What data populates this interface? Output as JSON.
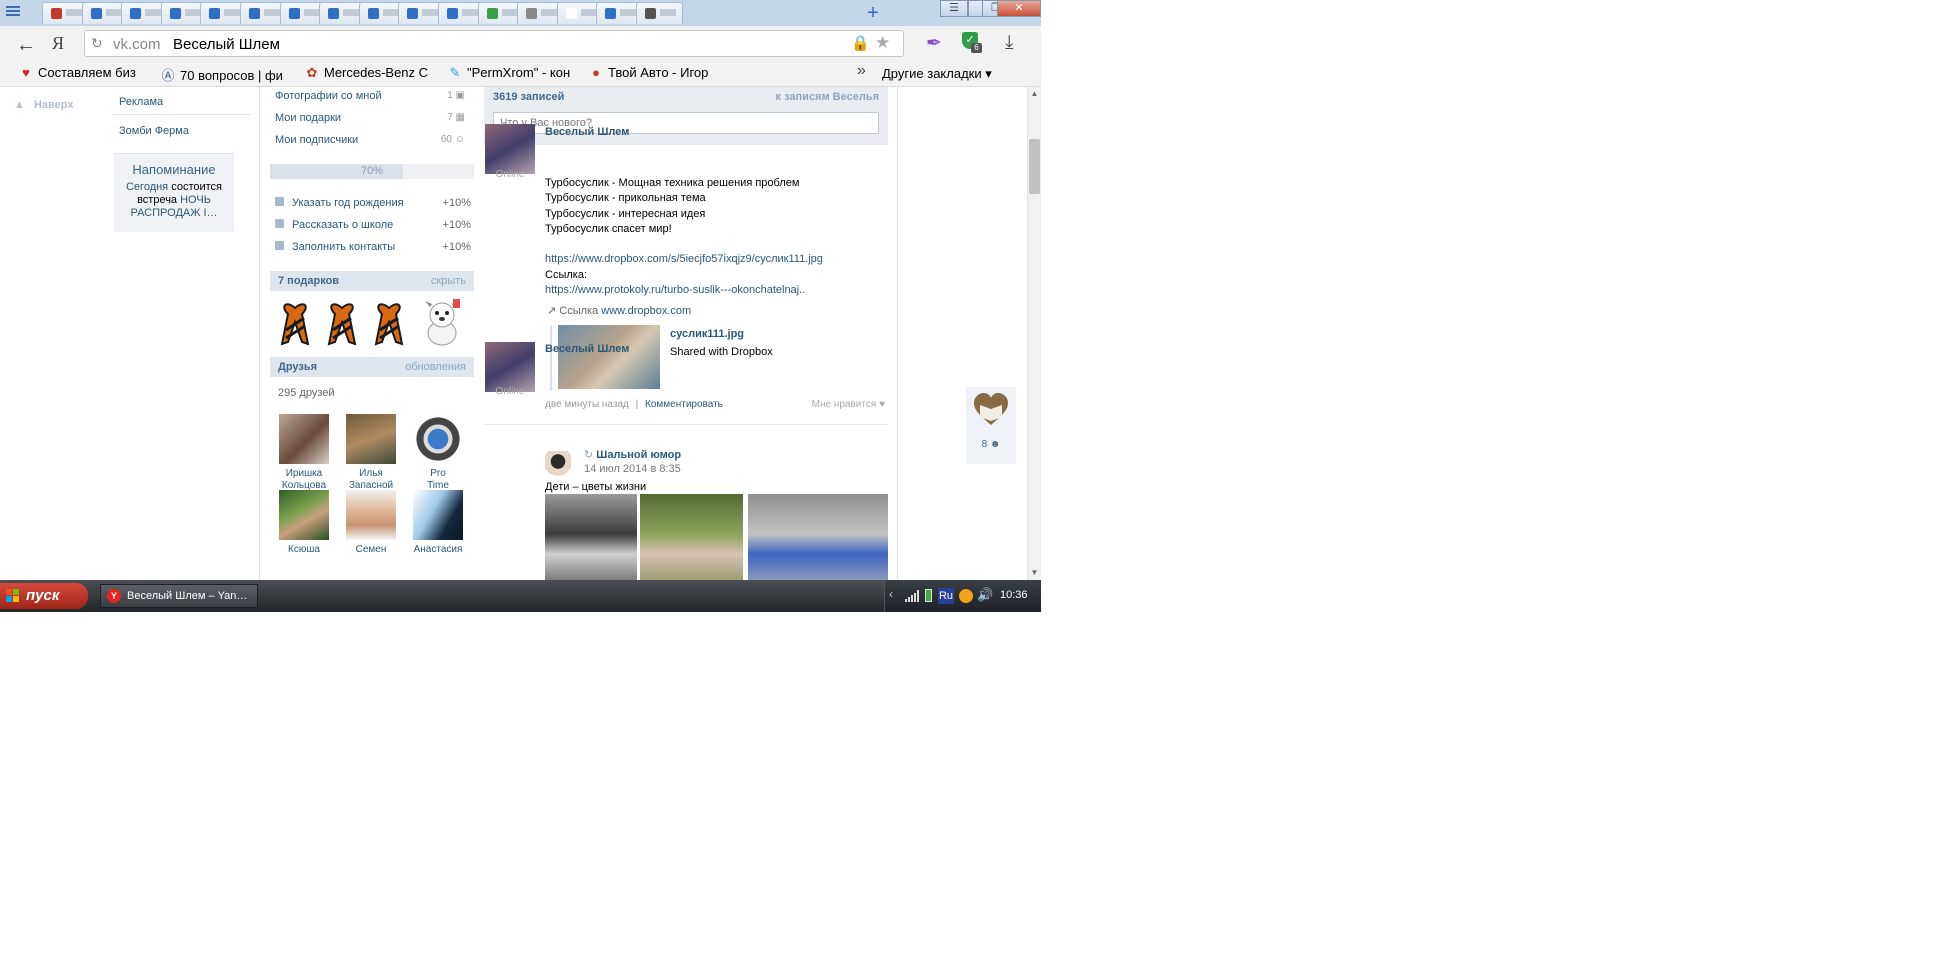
{
  "browser": {
    "tab_count": 16,
    "tab_favicon_colors": [
      "#c0392b",
      "#2f6fc4",
      "#2f6fc4",
      "#2f6fc4",
      "#2f6fc4",
      "#2f6fc4",
      "#2f6fc4",
      "#2f6fc4",
      "#2f6fc4",
      "#2f6fc4",
      "#2f6fc4",
      "#3a9e47",
      "#888888",
      "#ffffff",
      "#2f6fc4",
      "#555555"
    ],
    "new_tab_label": "+",
    "window_buttons": {
      "minimize": "—",
      "maximize": "❐",
      "close": "✕"
    },
    "back_icon": "arrow-left-icon",
    "yandex_logo": "Я",
    "address": {
      "domain": "vk.com",
      "title": "Веселый Шлем"
    },
    "bookmarks": [
      {
        "label": "Составляем биз",
        "icon": "♥",
        "color": "#d0202a"
      },
      {
        "label": "70 вопросов | фи",
        "icon": "(A)",
        "color": "#3b5b9a"
      },
      {
        "label": "Mercedes-Benz C",
        "icon": "♣",
        "color": "#c0392b"
      },
      {
        "label": "\"PermXrom\" - кон",
        "icon": "✎",
        "color": "#2a9fd8"
      },
      {
        "label": "Твой Авто - Игор",
        "icon": "🚗",
        "color": "#c0392b"
      }
    ],
    "bookmarks_more": "»",
    "other_bookmarks": "Другие закладки ▾",
    "extension_badge": "6"
  },
  "page": {
    "back_to_top": "Наверх",
    "left_menu": [
      "Реклама",
      "Зомби Ферма"
    ],
    "reminder": {
      "title": "Напоминание",
      "text_before": "Сегодня",
      "text_mid": "состоится встреча",
      "text_link": "НОЧЬ РАСПРОДАЖ І…"
    },
    "profile_links": [
      {
        "label": "Фотографии со мной",
        "count": "1"
      },
      {
        "label": "Мои подарки",
        "count": "7"
      },
      {
        "label": "Мои подписчики",
        "count": "60"
      }
    ],
    "profile_completion": {
      "percent_label": "70%",
      "fraction": 0.7
    },
    "profile_tasks": [
      {
        "label": "Указать год рождения",
        "bonus": "+10%"
      },
      {
        "label": "Рассказать о школе",
        "bonus": "+10%"
      },
      {
        "label": "Заполнить контакты",
        "bonus": "+10%"
      }
    ],
    "gifts": {
      "title": "7 подарков",
      "action": "скрыть"
    },
    "friends": {
      "title": "Друзья",
      "action": "обновления",
      "count_label": "295 друзей",
      "items": [
        {
          "first": "Иришка",
          "last": "Кольцова"
        },
        {
          "first": "Илья",
          "last": "Запасной"
        },
        {
          "first": "Pro",
          "last": "Time"
        },
        {
          "first": "Ксюша",
          "last": ""
        },
        {
          "first": "Семен",
          "last": ""
        },
        {
          "first": "Анастасия",
          "last": ""
        }
      ]
    },
    "wall": {
      "count": "3619 записей",
      "to_posts": "к записям Веселья",
      "input_placeholder": "Что у Вас нового?"
    },
    "post1": {
      "author": "Веселый Шлем",
      "status": "Online",
      "lines": [
        "Турбосуслик - Мощная техника решения проблем",
        "Турбосуслик - прикольная тема",
        "Турбосуслик - интересная идея",
        "Турбосуслик спасет мир!"
      ],
      "link1": "https://www.dropbox.com/s/5iecjfo57ixqjz9/суслик111.jpg",
      "link_label": "Ссылка:",
      "link2": "https://www.protokoly.ru/turbo-suslik---okonchatelnaj..",
      "attachment_prefix": "Ссылка",
      "attachment_domain": "www.dropbox.com",
      "attachment_title": "суслик111.jpg",
      "attachment_subtitle": "Shared with Dropbox",
      "time": "две минуты назад",
      "separator": "|",
      "comment": "Комментировать",
      "like": "Мне нравится"
    },
    "post2": {
      "author": "Веселый Шлем",
      "status": "Online",
      "repost_source": "Шальной юмор",
      "repost_date": "14 июл 2014 в 8:35",
      "text": "Дети – цветы жизни"
    },
    "side_widget_count": "8"
  },
  "scrollbar": {
    "up": "▲",
    "down": "▼"
  },
  "taskbar": {
    "start_label": "пуск",
    "window_title": "Веселый Шлем – Yan…",
    "tray_lang": "Ru",
    "clock": "10:36"
  }
}
